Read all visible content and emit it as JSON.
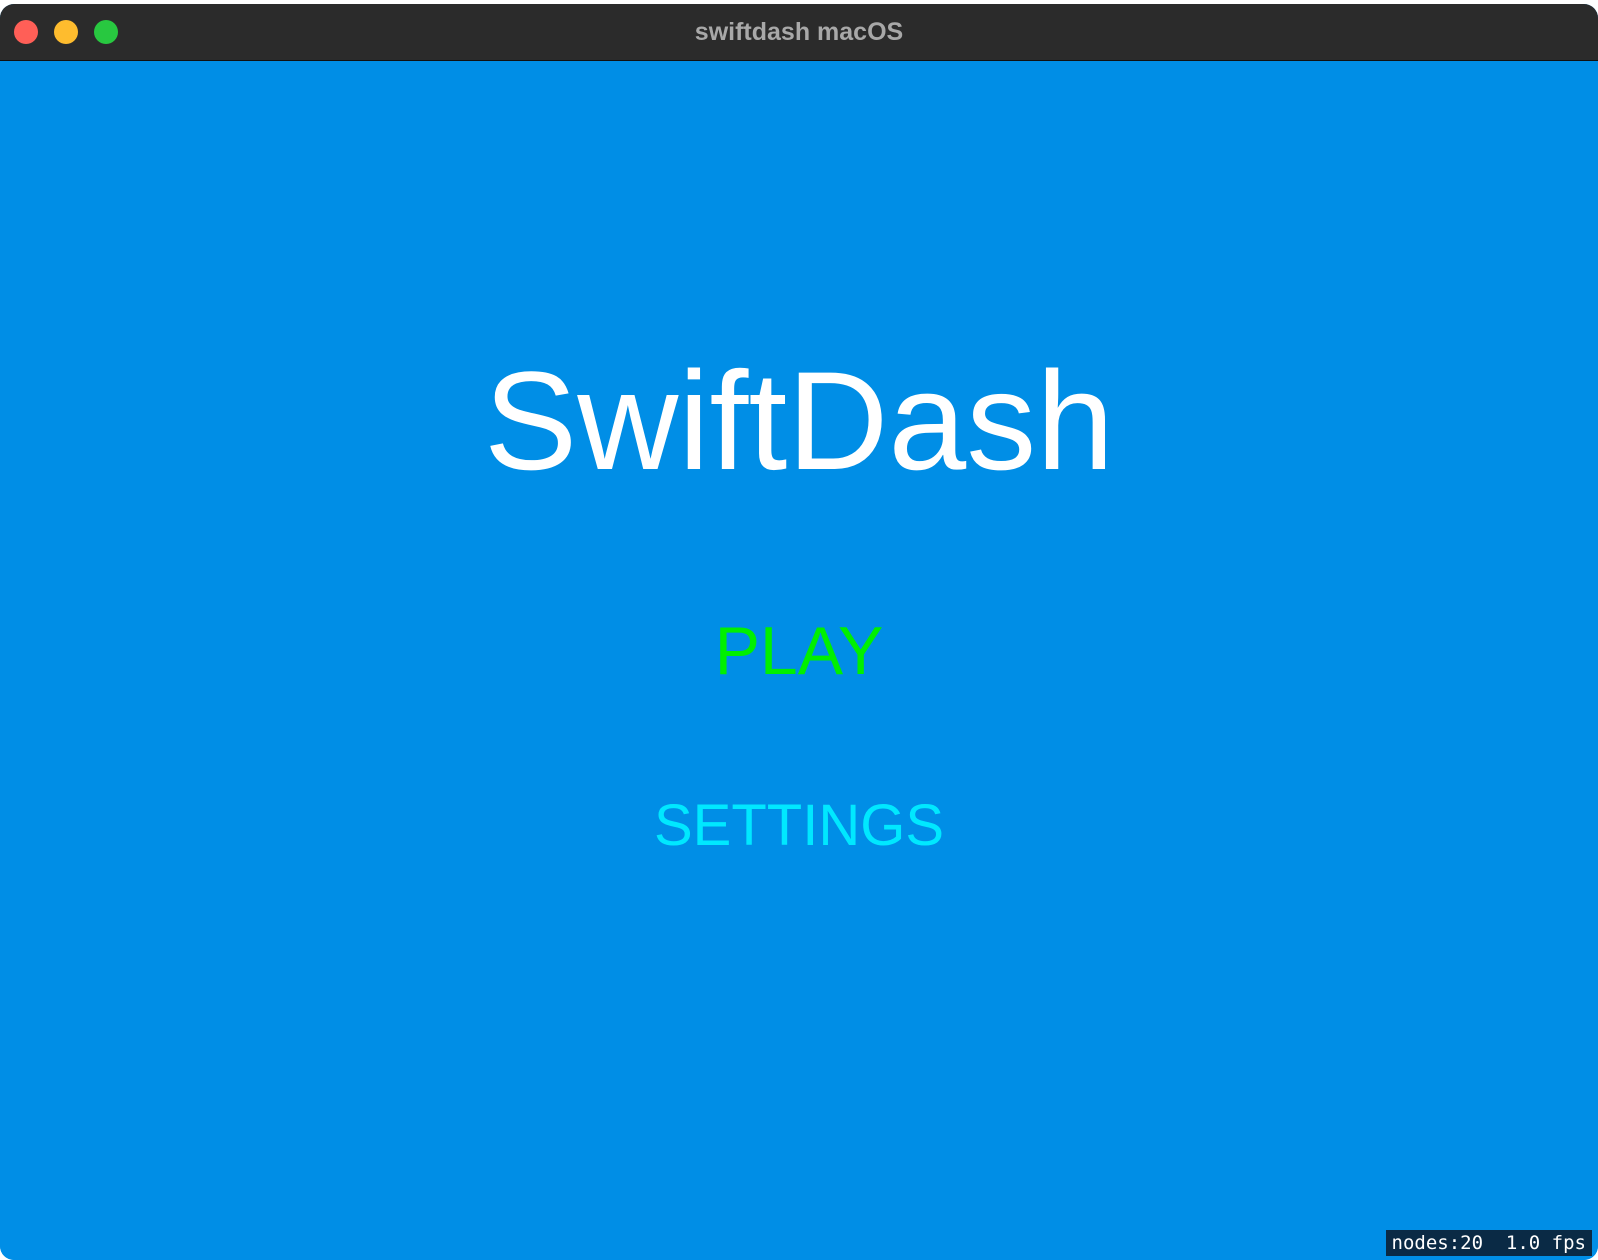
{
  "window": {
    "title": "swiftdash macOS"
  },
  "game": {
    "title": "SwiftDash",
    "menu": {
      "play_label": "PLAY",
      "play_color": "#00f000",
      "settings_label": "SETTINGS",
      "settings_color": "#00e8ff"
    },
    "background_color": "#008ee6"
  },
  "stats": {
    "text": "nodes:20  1.0 fps"
  }
}
